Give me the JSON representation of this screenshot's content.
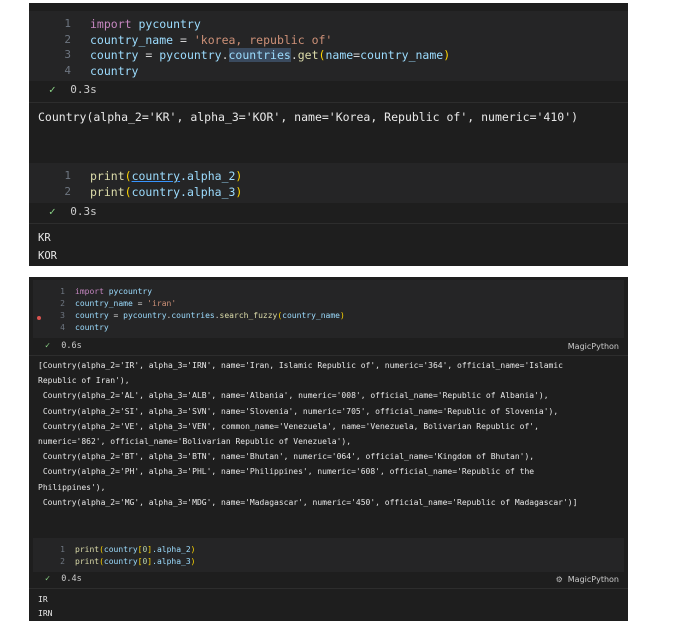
{
  "top": {
    "cell1": {
      "lines": [
        {
          "n": "1",
          "tokens": [
            {
              "t": "import ",
              "c": "kw"
            },
            {
              "t": "pycountry",
              "c": "var"
            }
          ]
        },
        {
          "n": "2",
          "tokens": [
            {
              "t": "country_name",
              "c": "var"
            },
            {
              "t": " = ",
              "c": "op"
            },
            {
              "t": "'korea, republic of'",
              "c": "str"
            }
          ]
        },
        {
          "n": "3",
          "tokens": [
            {
              "t": "country",
              "c": "var"
            },
            {
              "t": " = ",
              "c": "op"
            },
            {
              "t": "pycountry",
              "c": "var"
            },
            {
              "t": ".",
              "c": "op"
            },
            {
              "t": "countries",
              "c": "hl"
            },
            {
              "t": ".",
              "c": "op"
            },
            {
              "t": "get",
              "c": "fn"
            },
            {
              "t": "(",
              "c": "br1"
            },
            {
              "t": "name",
              "c": "var"
            },
            {
              "t": "=",
              "c": "op"
            },
            {
              "t": "country_name",
              "c": "var"
            },
            {
              "t": ")",
              "c": "br1"
            }
          ]
        },
        {
          "n": "4",
          "tokens": [
            {
              "t": "country",
              "c": "var"
            }
          ]
        }
      ],
      "check": "✓",
      "time": "0.3s",
      "output": [
        "Country(alpha_2='KR', alpha_3='KOR', name='Korea, Republic of', numeric='410')"
      ]
    },
    "cell2": {
      "lines": [
        {
          "n": "1",
          "tokens": [
            {
              "t": "print",
              "c": "fn"
            },
            {
              "t": "(",
              "c": "br1"
            },
            {
              "t": "country",
              "c": "var ul"
            },
            {
              "t": ".alpha_2",
              "c": "var"
            },
            {
              "t": ")",
              "c": "br1"
            }
          ]
        },
        {
          "n": "2",
          "tokens": [
            {
              "t": "print",
              "c": "fn"
            },
            {
              "t": "(",
              "c": "br1"
            },
            {
              "t": "country",
              "c": "var"
            },
            {
              "t": ".alpha_3",
              "c": "var"
            },
            {
              "t": ")",
              "c": "br1"
            }
          ]
        }
      ],
      "check": "✓",
      "time": "0.3s",
      "output": [
        "KR",
        "KOR"
      ]
    }
  },
  "bottom": {
    "cell1": {
      "lines": [
        {
          "n": "1",
          "tokens": [
            {
              "t": "import ",
              "c": "kw"
            },
            {
              "t": "pycountry",
              "c": "var"
            }
          ]
        },
        {
          "n": "2",
          "tokens": [
            {
              "t": "country_name",
              "c": "var"
            },
            {
              "t": " = ",
              "c": "op"
            },
            {
              "t": "'iran'",
              "c": "str"
            }
          ]
        },
        {
          "n": "3",
          "tokens": [
            {
              "t": "country",
              "c": "var"
            },
            {
              "t": " = ",
              "c": "op"
            },
            {
              "t": "pycountry",
              "c": "var"
            },
            {
              "t": ".",
              "c": "op"
            },
            {
              "t": "countries",
              "c": "var"
            },
            {
              "t": ".",
              "c": "op"
            },
            {
              "t": "search_fuzzy",
              "c": "fn"
            },
            {
              "t": "(",
              "c": "br1"
            },
            {
              "t": "country_name",
              "c": "var"
            },
            {
              "t": ")",
              "c": "br1"
            }
          ]
        },
        {
          "n": "4",
          "tokens": [
            {
              "t": "country",
              "c": "var"
            }
          ]
        }
      ],
      "check": "✓",
      "time": "0.6s",
      "language": "MagicPython",
      "output": [
        "[Country(alpha_2='IR', alpha_3='IRN', name='Iran, Islamic Republic of', numeric='364', official_name='Islamic",
        "Republic of Iran'),",
        " Country(alpha_2='AL', alpha_3='ALB', name='Albania', numeric='008', official_name='Republic of Albania'),",
        " Country(alpha_2='SI', alpha_3='SVN', name='Slovenia', numeric='705', official_name='Republic of Slovenia'),",
        " Country(alpha_2='VE', alpha_3='VEN', common_name='Venezuela', name='Venezuela, Bolivarian Republic of',",
        "numeric='862', official_name='Bolivarian Republic of Venezuela'),",
        " Country(alpha_2='BT', alpha_3='BTN', name='Bhutan', numeric='064', official_name='Kingdom of Bhutan'),",
        " Country(alpha_2='PH', alpha_3='PHL', name='Philippines', numeric='608', official_name='Republic of the",
        "Philippines'),",
        " Country(alpha_2='MG', alpha_3='MDG', name='Madagascar', numeric='450', official_name='Republic of Madagascar')]"
      ]
    },
    "cell2": {
      "lines": [
        {
          "n": "1",
          "tokens": [
            {
              "t": "print",
              "c": "fn"
            },
            {
              "t": "(",
              "c": "br1"
            },
            {
              "t": "country",
              "c": "var"
            },
            {
              "t": "[",
              "c": "br1"
            },
            {
              "t": "0",
              "c": "num"
            },
            {
              "t": "]",
              "c": "br1"
            },
            {
              "t": ".alpha_2",
              "c": "var"
            },
            {
              "t": ")",
              "c": "br1"
            }
          ]
        },
        {
          "n": "2",
          "tokens": [
            {
              "t": "print",
              "c": "fn"
            },
            {
              "t": "(",
              "c": "br1"
            },
            {
              "t": "country",
              "c": "var"
            },
            {
              "t": "[",
              "c": "br1"
            },
            {
              "t": "0",
              "c": "num"
            },
            {
              "t": "]",
              "c": "br1"
            },
            {
              "t": ".alpha_3",
              "c": "var"
            },
            {
              "t": ")",
              "c": "br1"
            }
          ]
        }
      ],
      "check": "✓",
      "time": "0.4s",
      "language": "MagicPython",
      "kernel_icon": "kernel-icon",
      "output": [
        "IR",
        "IRN"
      ]
    }
  }
}
